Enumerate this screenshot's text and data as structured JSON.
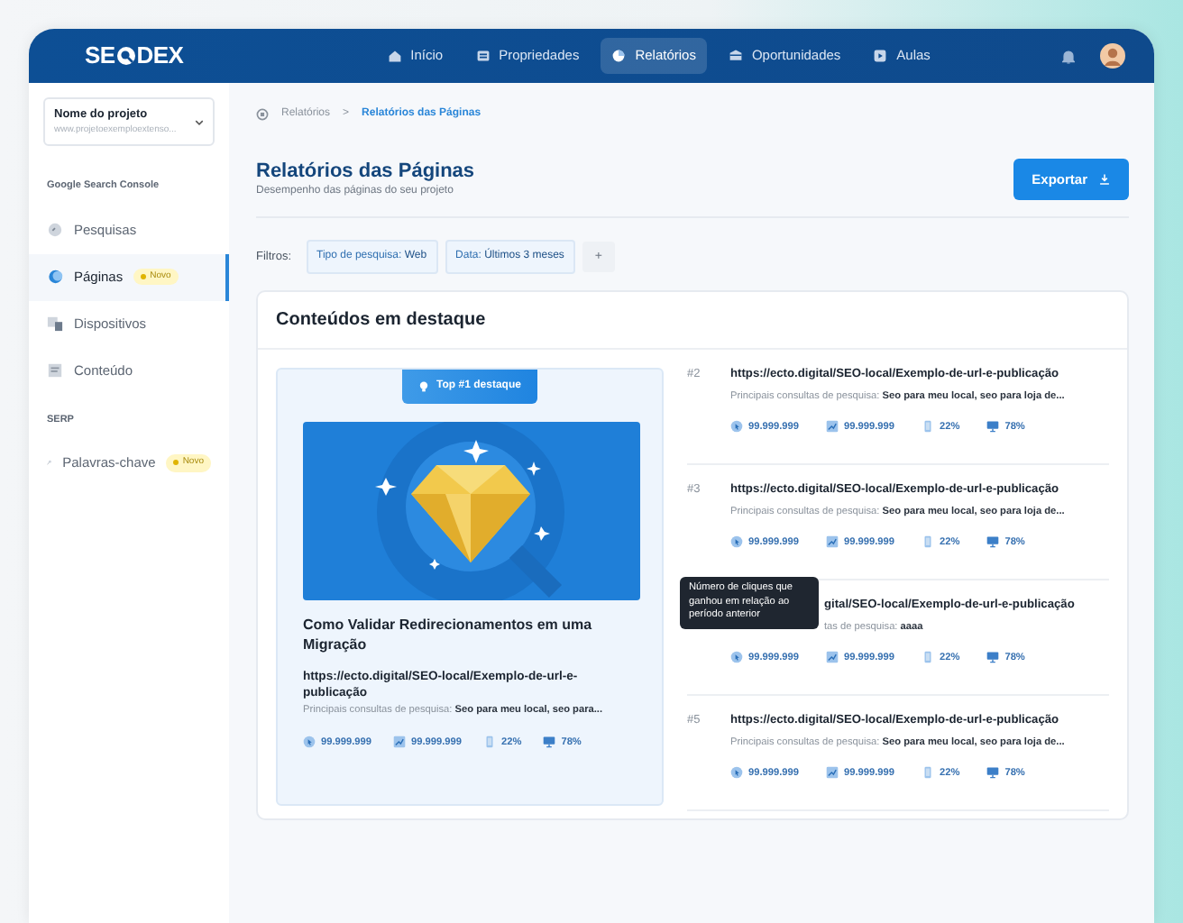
{
  "brand": {
    "left": "SE",
    "right": "DEX"
  },
  "nav": [
    {
      "label": "Início",
      "selected": false
    },
    {
      "label": "Propriedades",
      "selected": false
    },
    {
      "label": "Relatórios",
      "selected": true
    },
    {
      "label": "Oportunidades",
      "selected": false
    },
    {
      "label": "Aulas",
      "selected": false
    }
  ],
  "project": {
    "name": "Nome do projeto",
    "url": "www.projetoexemploextenso..."
  },
  "sidebar": [
    {
      "title": "Google Search Console",
      "items": [
        {
          "label": "Pesquisas",
          "selected": false
        },
        {
          "label": "Páginas",
          "selected": true,
          "badge": "Novo"
        },
        {
          "label": "Dispositivos",
          "selected": false
        },
        {
          "label": "Conteúdo",
          "selected": false
        }
      ]
    },
    {
      "title": "SERP",
      "items": [
        {
          "label": "Palavras-chave",
          "selected": false,
          "badge": "Novo"
        }
      ]
    }
  ],
  "breadcrumb": {
    "items": [
      "Relatórios",
      "Relatórios das Páginas"
    ],
    "separator": ">"
  },
  "page": {
    "title": "Relatórios das Páginas",
    "subtitle": "Desempenho das páginas do seu projeto",
    "export": "Exportar"
  },
  "filters": {
    "label": "Filtros:",
    "add": "+",
    "chips": [
      {
        "key": "Tipo de pesquisa:",
        "value": "Web"
      },
      {
        "key": "Data:",
        "value": "Últimos 3 meses"
      }
    ]
  },
  "featured_card": {
    "title": "Conteúdos em destaque",
    "top": {
      "badge": "Top #1 destaque",
      "title": "Como Validar Redirecionamentos em uma Migração",
      "url": "https://ecto.digital/SEO-local/Exemplo-de-url-e-publicação",
      "query_label": "Principais consultas de pesquisa:",
      "query": "Seo para meu local, seo para...",
      "metrics": [
        {
          "kind": "clicks",
          "value": "99.999.999"
        },
        {
          "kind": "impressions",
          "value": "99.999.999"
        },
        {
          "kind": "mobile",
          "value": "22%"
        },
        {
          "kind": "desktop",
          "value": "78%"
        }
      ]
    },
    "rows": [
      {
        "kind": "full",
        "rank": "#2",
        "url": "https://ecto.digital/SEO-local/Exemplo-de-url-e-publicação",
        "query_label": "Principais consultas de pesquisa:",
        "query": "Seo para meu local, seo para loja de...",
        "metrics": [
          {
            "kind": "clicks",
            "value": "99.999.999"
          },
          {
            "kind": "impressions",
            "value": "99.999.999"
          },
          {
            "kind": "mobile",
            "value": "22%"
          },
          {
            "kind": "desktop",
            "value": "78%"
          }
        ]
      },
      {
        "kind": "full",
        "rank": "#3",
        "url": "https://ecto.digital/SEO-local/Exemplo-de-url-e-publicação",
        "query_label": "Principais consultas de pesquisa:",
        "query": "Seo para meu local, seo para loja de...",
        "metrics": [
          {
            "kind": "clicks",
            "value": "99.999.999"
          },
          {
            "kind": "impressions",
            "value": "99.999.999"
          },
          {
            "kind": "mobile",
            "value": "22%"
          },
          {
            "kind": "desktop",
            "value": "78%"
          }
        ]
      },
      {
        "kind": "covered",
        "url": "gital/SEO-local/Exemplo-de-url-e-publicação",
        "query_label": "tas de pesquisa:",
        "query": "aaaa",
        "tooltip": "Número de cliques que ganhou em relação ao período anterior",
        "metrics": [
          {
            "kind": "clicks",
            "value": "99.999.999"
          },
          {
            "kind": "impressions",
            "value": "99.999.999"
          },
          {
            "kind": "mobile",
            "value": "22%"
          },
          {
            "kind": "desktop",
            "value": "78%"
          }
        ]
      },
      {
        "kind": "full",
        "rank": "#5",
        "url": "https://ecto.digital/SEO-local/Exemplo-de-url-e-publicação",
        "query_label": "Principais consultas de pesquisa:",
        "query": "Seo para meu local, seo para loja de...",
        "metrics": [
          {
            "kind": "clicks",
            "value": "99.999.999"
          },
          {
            "kind": "impressions",
            "value": "99.999.999"
          },
          {
            "kind": "mobile",
            "value": "22%"
          },
          {
            "kind": "desktop",
            "value": "78%"
          }
        ]
      }
    ]
  }
}
